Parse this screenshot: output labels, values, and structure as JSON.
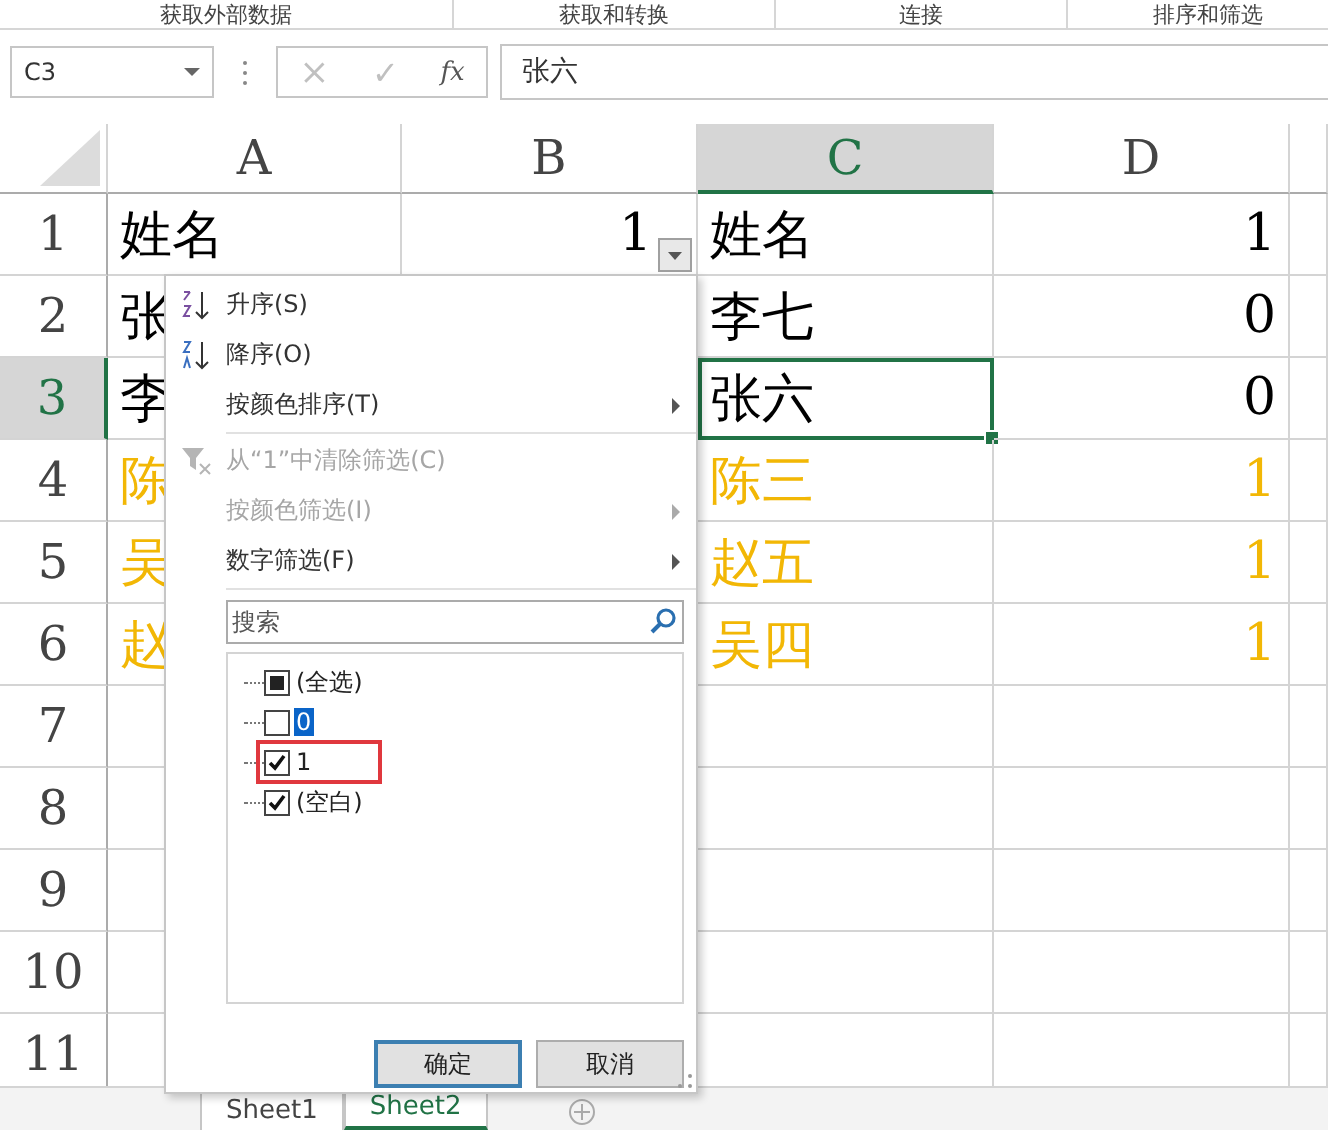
{
  "ribbon": {
    "groups": [
      "获取外部数据",
      "获取和转换",
      "连接",
      "排序和筛选"
    ]
  },
  "formula_bar": {
    "name_box": "C3",
    "cancel": "×",
    "enter": "✓",
    "function": "fx",
    "value": "张六"
  },
  "sheet": {
    "columns": [
      {
        "label": "A",
        "selected": false,
        "filter": false
      },
      {
        "label": "B",
        "selected": false,
        "filter": true
      },
      {
        "label": "C",
        "selected": true,
        "filter": false
      },
      {
        "label": "D",
        "selected": false,
        "filter": false
      }
    ],
    "rows": [
      {
        "number": "1",
        "selected": false,
        "color": "#000000",
        "cells": [
          {
            "text": "姓名",
            "selected": false
          },
          {
            "text": "1",
            "selected": false
          },
          {
            "text": "姓名",
            "selected": false
          },
          {
            "text": "1",
            "selected": false
          }
        ]
      },
      {
        "number": "2",
        "selected": false,
        "color": "#000000",
        "cells": [
          {
            "text": "张",
            "selected": false
          },
          null,
          {
            "text": "李七",
            "selected": false
          },
          {
            "text": "0",
            "selected": false
          }
        ]
      },
      {
        "number": "3",
        "selected": true,
        "color": "#000000",
        "cells": [
          {
            "text": "李",
            "selected": false
          },
          null,
          {
            "text": "张六",
            "selected": true
          },
          {
            "text": "0",
            "selected": false
          }
        ]
      },
      {
        "number": "4",
        "selected": false,
        "color": "#f2b705",
        "cells": [
          {
            "text": "陈",
            "selected": false
          },
          null,
          {
            "text": "陈三",
            "selected": false
          },
          {
            "text": "1",
            "selected": false
          }
        ]
      },
      {
        "number": "5",
        "selected": false,
        "color": "#f2b705",
        "cells": [
          {
            "text": "吴",
            "selected": false
          },
          null,
          {
            "text": "赵五",
            "selected": false
          },
          {
            "text": "1",
            "selected": false
          }
        ]
      },
      {
        "number": "6",
        "selected": false,
        "color": "#f2b705",
        "cells": [
          {
            "text": "赵",
            "selected": false
          },
          null,
          {
            "text": "吴四",
            "selected": false
          },
          {
            "text": "1",
            "selected": false
          }
        ]
      },
      {
        "number": "7",
        "selected": false
      },
      {
        "number": "8",
        "selected": false
      },
      {
        "number": "9",
        "selected": false
      },
      {
        "number": "10",
        "selected": false
      },
      {
        "number": "11",
        "selected": false
      }
    ]
  },
  "filter_menu": {
    "items": [
      {
        "label": "升序(S)",
        "disabled": false,
        "submenu": false
      },
      {
        "label": "降序(O)",
        "disabled": false,
        "submenu": false
      },
      {
        "label": "按颜色排序(T)",
        "disabled": false,
        "submenu": true
      },
      {
        "label": "从“1”中清除筛选(C)",
        "disabled": true,
        "submenu": false
      },
      {
        "label": "按颜色筛选(I)",
        "disabled": true,
        "submenu": true
      },
      {
        "label": "数字筛选(F)",
        "disabled": false,
        "submenu": true
      }
    ],
    "search": {
      "placeholder": "搜索"
    },
    "values": [
      {
        "label": "(全选)",
        "checked": false,
        "indeterminate": true,
        "selected": false,
        "annotated": false
      },
      {
        "label": "0",
        "checked": false,
        "indeterminate": false,
        "selected": true,
        "annotated": false
      },
      {
        "label": "1",
        "checked": true,
        "indeterminate": false,
        "selected": false,
        "annotated": true
      },
      {
        "label": "(空白)",
        "checked": true,
        "indeterminate": false,
        "selected": false,
        "annotated": false
      }
    ],
    "buttons": [
      {
        "label": "确定",
        "primary": true
      },
      {
        "label": "取消",
        "primary": false
      }
    ]
  },
  "sheet_tabs": [
    {
      "label": "Sheet1",
      "selected": false
    },
    {
      "label": "Sheet2",
      "selected": true
    }
  ]
}
